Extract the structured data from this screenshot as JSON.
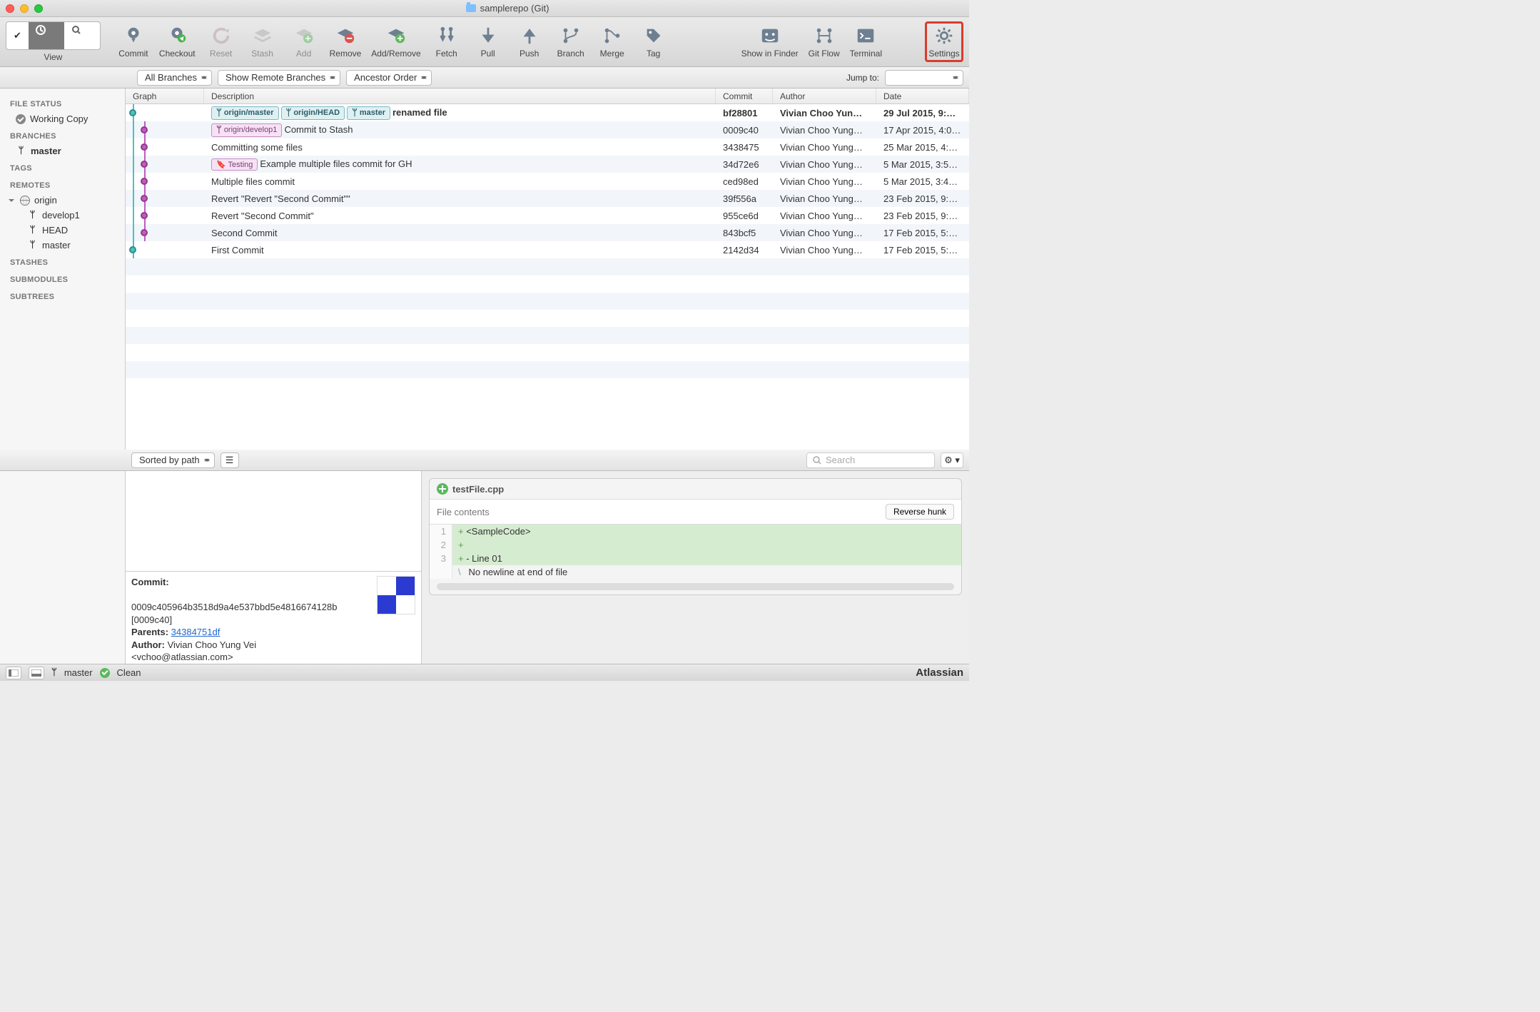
{
  "title": "samplerepo (Git)",
  "toolbar": {
    "view": "View",
    "commit": "Commit",
    "checkout": "Checkout",
    "reset": "Reset",
    "stash": "Stash",
    "add": "Add",
    "remove": "Remove",
    "addremove": "Add/Remove",
    "fetch": "Fetch",
    "pull": "Pull",
    "push": "Push",
    "branch": "Branch",
    "merge": "Merge",
    "tag": "Tag",
    "finder": "Show in Finder",
    "gitflow": "Git Flow",
    "terminal": "Terminal",
    "settings": "Settings"
  },
  "filter": {
    "branches": "All Branches",
    "remote": "Show Remote Branches",
    "order": "Ancestor Order",
    "jump": "Jump to:"
  },
  "sidebar": {
    "filestatus": "FILE STATUS",
    "workingcopy": "Working Copy",
    "branches": "BRANCHES",
    "master": "master",
    "tags": "TAGS",
    "remotes": "REMOTES",
    "origin": "origin",
    "remote_items": [
      "develop1",
      "HEAD",
      "master"
    ],
    "stashes": "STASHES",
    "submodules": "SUBMODULES",
    "subtrees": "SUBTREES"
  },
  "columns": {
    "graph": "Graph",
    "desc": "Description",
    "commit": "Commit",
    "author": "Author",
    "date": "Date"
  },
  "commits": [
    {
      "badges": [
        {
          "t": "origin/master",
          "c": "blue"
        },
        {
          "t": "origin/HEAD",
          "c": "blue"
        },
        {
          "t": "master",
          "c": "blue"
        }
      ],
      "desc": "renamed file",
      "hash": "bf28801",
      "author": "Vivian Choo Yun…",
      "date": "29 Jul 2015, 9:…",
      "sel": true,
      "lane": 0,
      "color": "teal"
    },
    {
      "badges": [
        {
          "t": "origin/develop1",
          "c": "pink"
        }
      ],
      "desc": "Commit to Stash",
      "hash": "0009c40",
      "author": "Vivian Choo Yung…",
      "date": "17 Apr 2015, 4:0…",
      "lane": 1,
      "color": "mag"
    },
    {
      "badges": [],
      "desc": "Committing some files",
      "hash": "3438475",
      "author": "Vivian Choo Yung…",
      "date": "25 Mar 2015, 4:…",
      "lane": 1,
      "color": "mag"
    },
    {
      "badges": [
        {
          "t": "Testing",
          "c": "pink",
          "tag": true
        }
      ],
      "desc": "Example multiple files commit for GH",
      "hash": "34d72e6",
      "author": "Vivian Choo Yung…",
      "date": "5 Mar 2015, 3:5…",
      "lane": 1,
      "color": "mag"
    },
    {
      "badges": [],
      "desc": "Multiple files commit",
      "hash": "ced98ed",
      "author": "Vivian Choo Yung…",
      "date": "5 Mar 2015, 3:4…",
      "lane": 1,
      "color": "mag"
    },
    {
      "badges": [],
      "desc": "Revert \"Revert \"Second Commit\"\"",
      "hash": "39f556a",
      "author": "Vivian Choo Yung…",
      "date": "23 Feb 2015, 9:…",
      "lane": 1,
      "color": "mag"
    },
    {
      "badges": [],
      "desc": "Revert \"Second Commit\"",
      "hash": "955ce6d",
      "author": "Vivian Choo Yung…",
      "date": "23 Feb 2015, 9:…",
      "lane": 1,
      "color": "mag"
    },
    {
      "badges": [],
      "desc": "Second Commit",
      "hash": "843bcf5",
      "author": "Vivian Choo Yung…",
      "date": "17 Feb 2015, 5:…",
      "lane": 1,
      "color": "mag"
    },
    {
      "badges": [],
      "desc": "First Commit",
      "hash": "2142d34",
      "author": "Vivian Choo Yung…",
      "date": "17 Feb 2015, 5:…",
      "lane": 0,
      "color": "teal"
    }
  ],
  "bottombar": {
    "sort": "Sorted by path",
    "search": "Search"
  },
  "file": {
    "name": "testFile.cpp",
    "contents_label": "File contents",
    "reverse": "Reverse hunk",
    "lines": [
      {
        "n": "1",
        "mark": "+",
        "txt": "<SampleCode>",
        "cls": "add"
      },
      {
        "n": "2",
        "mark": "+",
        "txt": "",
        "cls": "add"
      },
      {
        "n": "3",
        "mark": "+",
        "txt": "- Line 01",
        "cls": "add"
      },
      {
        "n": "",
        "mark": "\\",
        "txt": "  No newline at end of file",
        "cls": "info"
      }
    ]
  },
  "commitinfo": {
    "label": "Commit:",
    "sha": "0009c405964b3518d9a4e537bbd5e4816674128b",
    "short": "[0009c40]",
    "parents_label": "Parents:",
    "parents": "34384751df",
    "author_label": "Author:",
    "author": "Vivian Choo Yung Vei",
    "email": "<vchoo@atlassian.com>"
  },
  "status": {
    "branch": "master",
    "clean": "Clean",
    "brand": "Atlassian"
  }
}
